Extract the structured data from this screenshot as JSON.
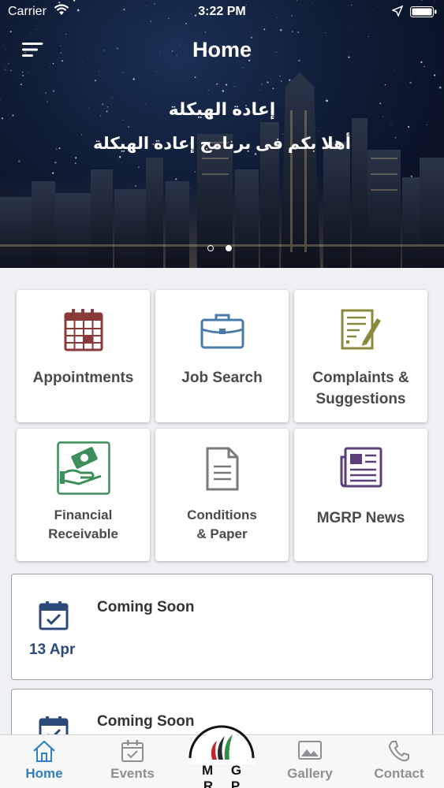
{
  "status_bar": {
    "carrier": "Carrier",
    "time": "3:22 PM"
  },
  "nav": {
    "title": "Home"
  },
  "hero": {
    "heading": "إعادة الهيكلة",
    "subtitle": "أهلا بكم فى برنامج إعادة الهيكلة",
    "page_count": 2,
    "active_page": 2
  },
  "tiles": [
    {
      "label": "Appointments",
      "icon": "calendar-icon"
    },
    {
      "label": "Job Search",
      "icon": "briefcase-icon"
    },
    {
      "label_line1": "Complaints &",
      "label_line2": "Suggestions",
      "icon": "complaint-form-icon"
    },
    {
      "label_line1": "Financial",
      "label_line2": "Receivable",
      "icon": "money-hand-icon"
    },
    {
      "label_line1": "Conditions",
      "label_line2": "& Paper",
      "icon": "document-icon"
    },
    {
      "label": "MGRP News",
      "icon": "newspaper-icon"
    }
  ],
  "events": [
    {
      "title": "Coming Soon",
      "date": "13 Apr"
    },
    {
      "title": "Coming Soon"
    }
  ],
  "tabbar": {
    "items": [
      {
        "label": "Home",
        "icon": "home-icon",
        "active": true
      },
      {
        "label": "Events",
        "icon": "events-icon",
        "active": false
      },
      {
        "label": "Gallery",
        "icon": "gallery-icon",
        "active": false
      },
      {
        "label": "Contact",
        "icon": "phone-icon",
        "active": false
      }
    ],
    "center_logo": "M G R P"
  },
  "colors": {
    "accent_blue": "#2e7fc3",
    "calendar_red": "#8b3a3a",
    "briefcase_blue": "#4a7aa8",
    "complaint_olive": "#8a8a3c",
    "money_green": "#3c8f5a",
    "doc_gray": "#7a7a7a",
    "news_purple": "#5a3f78",
    "event_blue": "#2b4a7a"
  }
}
